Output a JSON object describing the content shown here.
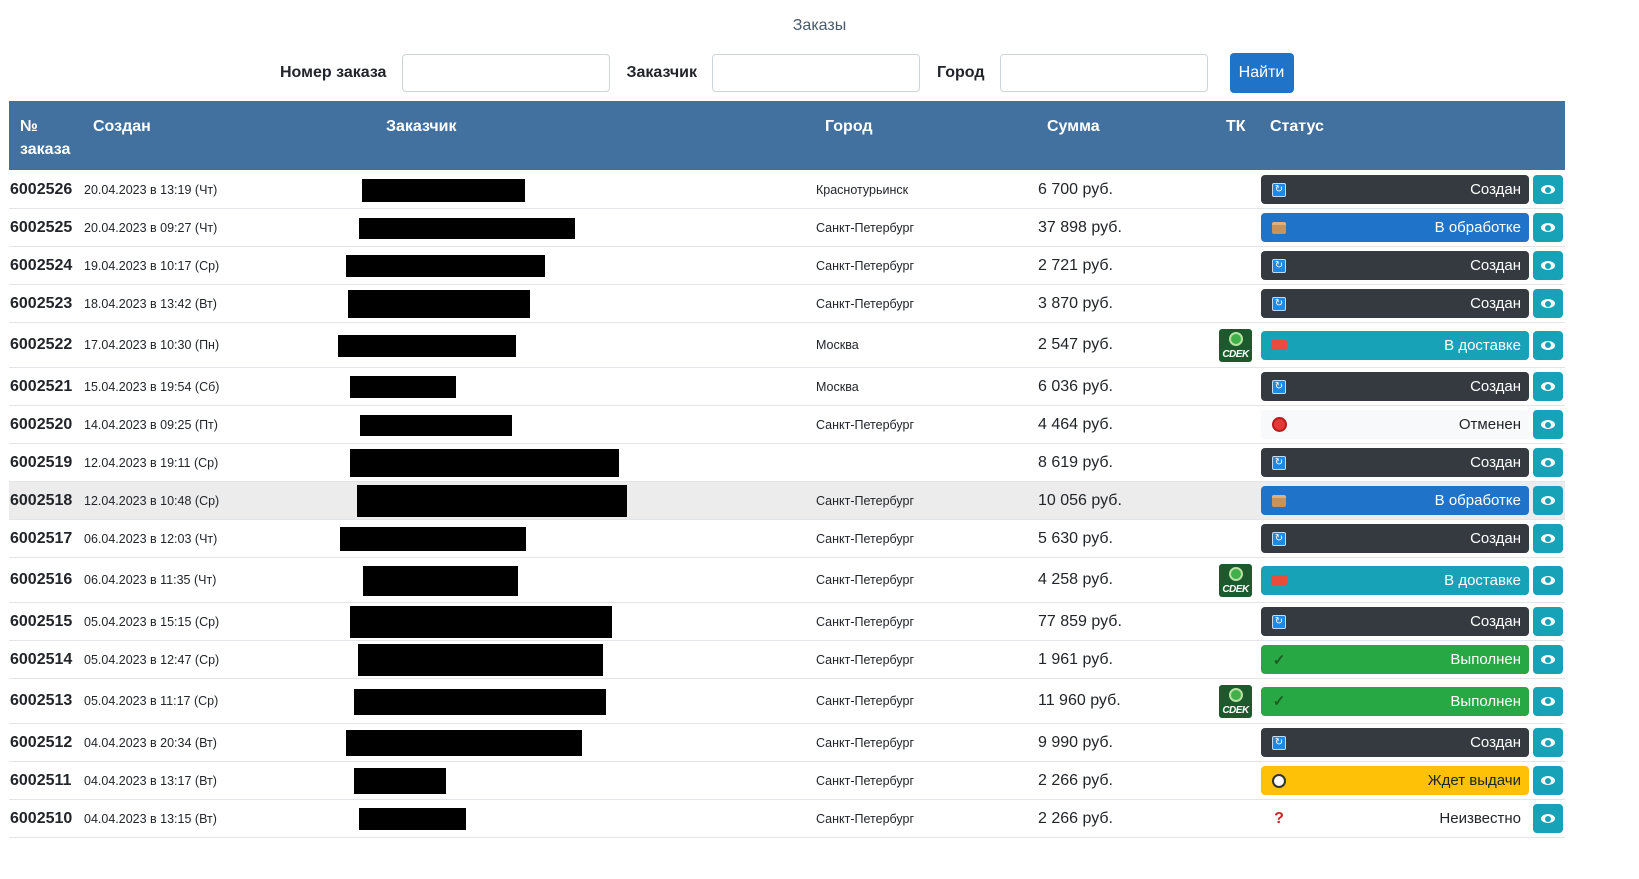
{
  "page_title": "Заказы",
  "search": {
    "order_label": "Номер заказа",
    "order_value": "",
    "customer_label": "Заказчик",
    "customer_value": "",
    "city_label": "Город",
    "city_value": "",
    "find_button": "Найти"
  },
  "table": {
    "headers": {
      "num": "№ заказа",
      "created": "Создан",
      "customer": "Заказчик",
      "city": "Город",
      "sum": "Сумма",
      "tk": "ТК",
      "status": "Статус"
    },
    "rows": [
      {
        "num": "6002526",
        "created": "20.04.2023 в 13:19 (Чт)",
        "city": "Краснотурьинск",
        "sum": "6 700 руб.",
        "tk": "",
        "status": "Создан",
        "status_style": "dark",
        "status_icon": "refresh-icon"
      },
      {
        "num": "6002525",
        "created": "20.04.2023 в 09:27 (Чт)",
        "city": "Санкт-Петербург",
        "sum": "37 898 руб.",
        "tk": "",
        "status": "В обработке",
        "status_style": "blue",
        "status_icon": "box-icon"
      },
      {
        "num": "6002524",
        "created": "19.04.2023 в 10:17 (Ср)",
        "city": "Санкт-Петербург",
        "sum": "2 721 руб.",
        "tk": "",
        "status": "Создан",
        "status_style": "dark",
        "status_icon": "refresh-icon"
      },
      {
        "num": "6002523",
        "created": "18.04.2023 в 13:42 (Вт)",
        "city": "Санкт-Петербург",
        "sum": "3 870 руб.",
        "tk": "",
        "status": "Создан",
        "status_style": "dark",
        "status_icon": "refresh-icon"
      },
      {
        "num": "6002522",
        "created": "17.04.2023 в 10:30 (Пн)",
        "city": "Москва",
        "sum": "2 547 руб.",
        "tk": "CDEK",
        "status": "В доставке",
        "status_style": "teal",
        "status_icon": "truck-icon"
      },
      {
        "num": "6002521",
        "created": "15.04.2023 в 19:54 (Сб)",
        "city": "Москва",
        "sum": "6 036 руб.",
        "tk": "",
        "status": "Создан",
        "status_style": "dark",
        "status_icon": "refresh-icon"
      },
      {
        "num": "6002520",
        "created": "14.04.2023 в 09:25 (Пт)",
        "city": "Санкт-Петербург",
        "sum": "4 464 руб.",
        "tk": "",
        "status": "Отменен",
        "status_style": "light",
        "status_icon": "cancel-icon"
      },
      {
        "num": "6002519",
        "created": "12.04.2023 в 19:11 (Ср)",
        "city": "",
        "sum": "8 619 руб.",
        "tk": "",
        "status": "Создан",
        "status_style": "dark",
        "status_icon": "refresh-icon"
      },
      {
        "num": "6002518",
        "created": "12.04.2023 в 10:48 (Ср)",
        "city": "Санкт-Петербург",
        "sum": "10 056 руб.",
        "tk": "",
        "status": "В обработке",
        "status_style": "blue",
        "status_icon": "box-icon"
      },
      {
        "num": "6002517",
        "created": "06.04.2023 в 12:03 (Чт)",
        "city": "Санкт-Петербург",
        "sum": "5 630 руб.",
        "tk": "",
        "status": "Создан",
        "status_style": "dark",
        "status_icon": "refresh-icon"
      },
      {
        "num": "6002516",
        "created": "06.04.2023 в 11:35 (Чт)",
        "city": "Санкт-Петербург",
        "sum": "4 258 руб.",
        "tk": "CDEK",
        "status": "В доставке",
        "status_style": "teal",
        "status_icon": "truck-icon"
      },
      {
        "num": "6002515",
        "created": "05.04.2023 в 15:15 (Ср)",
        "city": "Санкт-Петербург",
        "sum": "77 859 руб.",
        "tk": "",
        "status": "Создан",
        "status_style": "dark",
        "status_icon": "refresh-icon"
      },
      {
        "num": "6002514",
        "created": "05.04.2023 в 12:47 (Ср)",
        "city": "Санкт-Петербург",
        "sum": "1 961 руб.",
        "tk": "",
        "status": "Выполнен",
        "status_style": "green",
        "status_icon": "check-icon"
      },
      {
        "num": "6002513",
        "created": "05.04.2023 в 11:17 (Ср)",
        "city": "Санкт-Петербург",
        "sum": "11 960 руб.",
        "tk": "CDEK",
        "status": "Выполнен",
        "status_style": "green",
        "status_icon": "check-icon"
      },
      {
        "num": "6002512",
        "created": "04.04.2023 в 20:34 (Вт)",
        "city": "Санкт-Петербург",
        "sum": "9 990 руб.",
        "tk": "",
        "status": "Создан",
        "status_style": "dark",
        "status_icon": "refresh-icon"
      },
      {
        "num": "6002511",
        "created": "04.04.2023 в 13:17 (Вт)",
        "city": "Санкт-Петербург",
        "sum": "2 266 руб.",
        "tk": "",
        "status": "Ждет выдачи",
        "status_style": "yellow",
        "status_icon": "clock-icon"
      },
      {
        "num": "6002510",
        "created": "04.04.2023 в 13:15 (Вт)",
        "city": "Санкт-Петербург",
        "sum": "2 266 руб.",
        "tk": "",
        "status": "Неизвестно",
        "status_style": "none",
        "status_icon": "question-icon"
      }
    ]
  },
  "colors": {
    "header_bg": "#42709f",
    "primary": "#1f73c8",
    "dark": "#343a40",
    "teal": "#17a2b8",
    "green": "#28a745",
    "yellow": "#ffc107"
  }
}
